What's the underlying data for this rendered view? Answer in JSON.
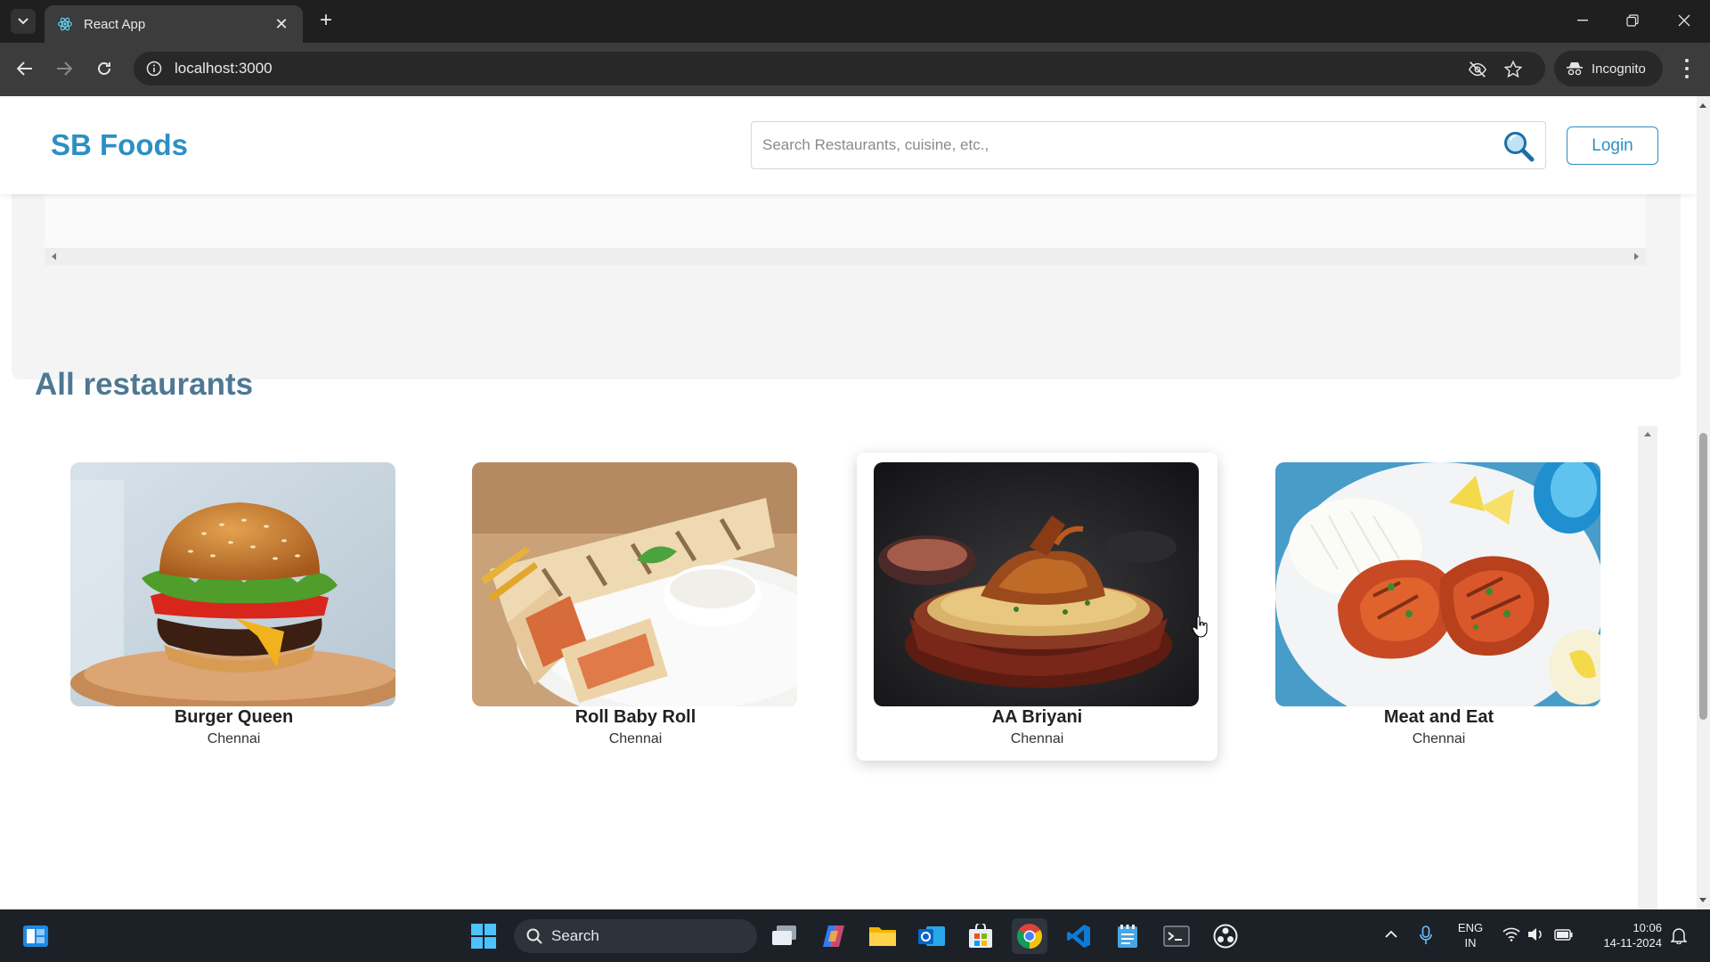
{
  "browser": {
    "tab_title": "React App",
    "url": "localhost:3000",
    "incognito_label": "Incognito"
  },
  "navbar": {
    "brand": "SB Foods",
    "search_placeholder": "Search Restaurants, cuisine, etc.,",
    "login_label": "Login"
  },
  "section": {
    "title": "All restaurants"
  },
  "restaurants": [
    {
      "name": "Burger Queen",
      "city": "Chennai",
      "image": "burger"
    },
    {
      "name": "Roll Baby Roll",
      "city": "Chennai",
      "image": "wrap-roll"
    },
    {
      "name": "AA Briyani",
      "city": "Chennai",
      "image": "biryani"
    },
    {
      "name": "Meat and Eat",
      "city": "Chennai",
      "image": "grilled-chicken"
    }
  ],
  "taskbar": {
    "search_label": "Search",
    "lang_line1": "ENG",
    "lang_line2": "IN",
    "time": "10:06",
    "date": "14-11-2024"
  },
  "colors": {
    "brand": "#2d8fc4",
    "section_title": "#4e7894"
  }
}
